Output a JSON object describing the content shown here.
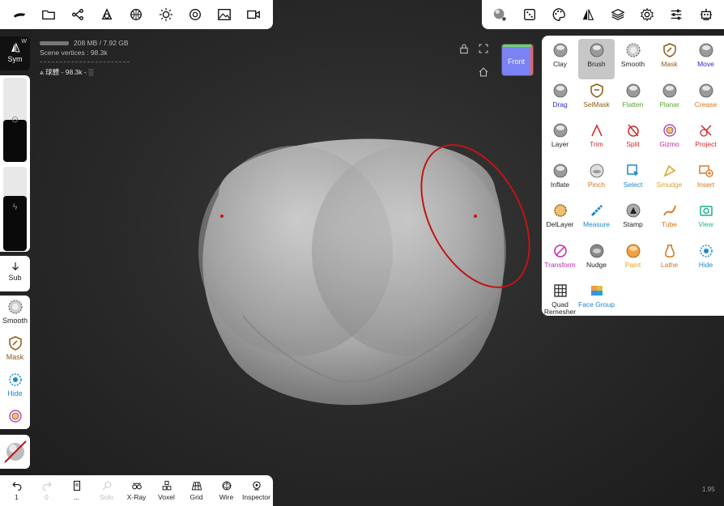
{
  "info": {
    "memory": "208 MB / 7.92 GB",
    "scene_vertices": "Scene vertices : 98.3k",
    "mesh_line": "球體 - 98.3k - ░"
  },
  "sym": {
    "label": "Sym",
    "w": "W"
  },
  "sub": {
    "label": "Sub"
  },
  "sliders": {
    "radius_level": 0.5,
    "intensity_level": 0.65
  },
  "quick_tools": [
    {
      "label": "Smooth",
      "icon": "smooth-sphere-icon",
      "color": "#222222"
    },
    {
      "label": "Mask",
      "icon": "mask-shield-icon",
      "color": "#8a5a12"
    },
    {
      "label": "Hide",
      "icon": "hide-icon",
      "color": "#1e88c8"
    }
  ],
  "viewcube": {
    "label": "Front",
    "color": "#7b82f4"
  },
  "tools": [
    {
      "label": "Clay",
      "color": "#222222",
      "icon": "clay-icon"
    },
    {
      "label": "Brush",
      "color": "#222222",
      "icon": "brush-icon",
      "active": true
    },
    {
      "label": "Smooth",
      "color": "#222222",
      "icon": "smooth-icon"
    },
    {
      "label": "Mask",
      "color": "#8a5a12",
      "icon": "mask-icon"
    },
    {
      "label": "Move",
      "color": "#2a2ad0",
      "icon": "move-icon"
    },
    {
      "label": "Drag",
      "color": "#2a2ad0",
      "icon": "drag-icon"
    },
    {
      "label": "SelMask",
      "color": "#8a5a12",
      "icon": "selmask-icon"
    },
    {
      "label": "Flatten",
      "color": "#5aa832",
      "icon": "flatten-icon"
    },
    {
      "label": "Planar",
      "color": "#5aa832",
      "icon": "planar-icon"
    },
    {
      "label": "Crease",
      "color": "#d4731c",
      "icon": "crease-icon"
    },
    {
      "label": "Layer",
      "color": "#222222",
      "icon": "layer-icon"
    },
    {
      "label": "Trim",
      "color": "#d02828",
      "icon": "trim-icon"
    },
    {
      "label": "Split",
      "color": "#d02828",
      "icon": "split-icon"
    },
    {
      "label": "Gizmo",
      "color": "#c028a8",
      "icon": "gizmo-icon"
    },
    {
      "label": "Project",
      "color": "#d02828",
      "icon": "project-icon"
    },
    {
      "label": "Inflate",
      "color": "#222222",
      "icon": "inflate-icon"
    },
    {
      "label": "Pinch",
      "color": "#d4731c",
      "icon": "pinch-icon"
    },
    {
      "label": "Select",
      "color": "#1e88c8",
      "icon": "select-icon"
    },
    {
      "label": "Smudge",
      "color": "#e0a21c",
      "icon": "smudge-icon"
    },
    {
      "label": "Insert",
      "color": "#d4731c",
      "icon": "insert-icon"
    },
    {
      "label": "DelLayer",
      "color": "#222222",
      "icon": "dellayer-icon"
    },
    {
      "label": "Measure",
      "color": "#1e88c8",
      "icon": "measure-icon"
    },
    {
      "label": "Stamp",
      "color": "#222222",
      "icon": "stamp-icon"
    },
    {
      "label": "Tube",
      "color": "#d4731c",
      "icon": "tube-icon"
    },
    {
      "label": "View",
      "color": "#1fae8e",
      "icon": "view-icon"
    },
    {
      "label": "Transform",
      "color": "#c028a8",
      "icon": "transform-icon"
    },
    {
      "label": "Nudge",
      "color": "#222222",
      "icon": "nudge-icon"
    },
    {
      "label": "Paint",
      "color": "#e0a21c",
      "icon": "paint-icon"
    },
    {
      "label": "Lathe",
      "color": "#d4731c",
      "icon": "lathe-icon"
    },
    {
      "label": "Hide",
      "color": "#1e88c8",
      "icon": "hide-icon"
    },
    {
      "label": "Quad Remesher",
      "color": "#222222",
      "icon": "quad-grid-icon"
    },
    {
      "label": "Face Group",
      "color": "#1e88c8",
      "icon": "facegroup-icon"
    }
  ],
  "bottom": [
    {
      "label": "1",
      "icon": "undo-icon"
    },
    {
      "label": "0",
      "icon": "redo-icon",
      "disabled": true
    },
    {
      "label": "...",
      "icon": "book-icon"
    },
    {
      "label": "Solo",
      "icon": "solo-icon",
      "disabled": true
    },
    {
      "label": "X-Ray",
      "icon": "xray-icon"
    },
    {
      "label": "Voxel",
      "icon": "voxel-icon"
    },
    {
      "label": "Grid",
      "icon": "grid-icon"
    },
    {
      "label": "Wire",
      "icon": "wire-icon"
    },
    {
      "label": "Inspector",
      "icon": "inspector-icon"
    }
  ],
  "fps": "1.95"
}
